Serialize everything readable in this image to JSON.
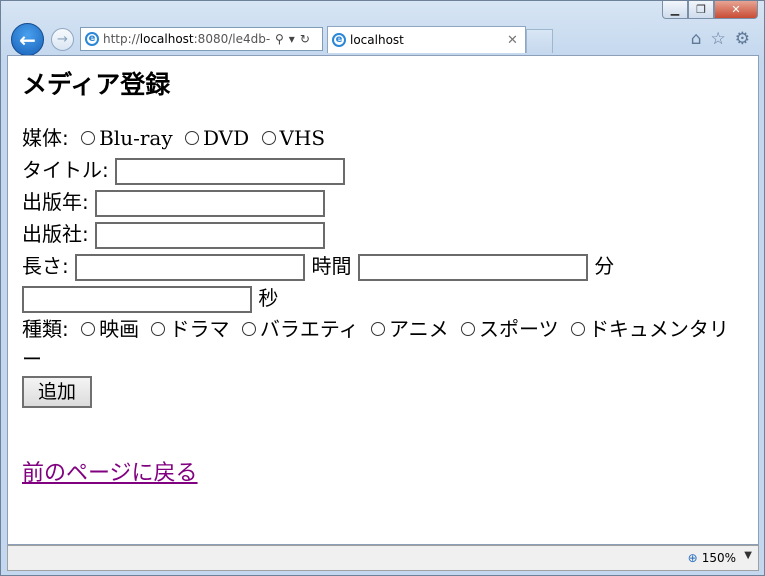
{
  "browser": {
    "address_prefix": "http://",
    "address_host": "localhost",
    "address_rest": ":8080/le4db-",
    "tab_title": "localhost",
    "zoom": "150%"
  },
  "page": {
    "heading": "メディア登録",
    "media_label": "媒体:",
    "media_options": [
      "Blu-ray",
      "DVD",
      "VHS"
    ],
    "title_label": "タイトル:",
    "year_label": "出版年:",
    "publisher_label": "出版社:",
    "length_label": "長さ:",
    "hours_unit": "時間",
    "minutes_unit": "分",
    "seconds_unit": "秒",
    "genre_label": "種類:",
    "genre_options": [
      "映画",
      "ドラマ",
      "バラエティ",
      "アニメ",
      "スポーツ",
      "ドキュメンタリー"
    ],
    "submit_label": "追加",
    "back_link": "前のページに戻る"
  },
  "colors": {
    "link_visited": "#800080",
    "back_button": "#1660b8"
  }
}
